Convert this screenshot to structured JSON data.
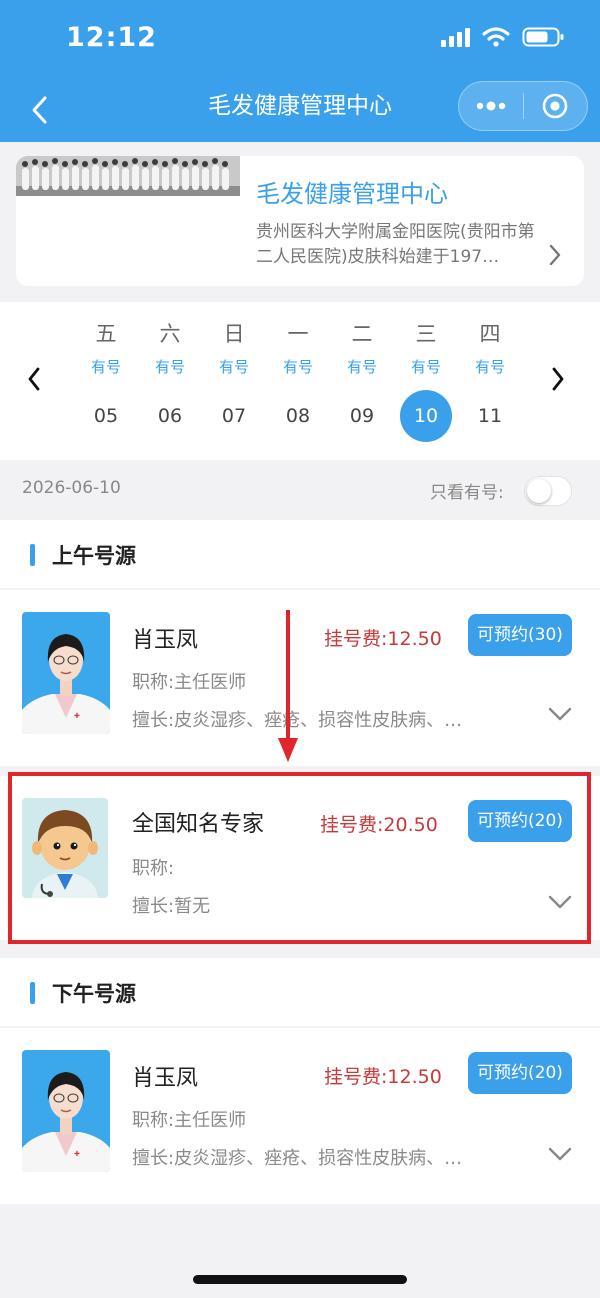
{
  "status_bar": {
    "time": "12:12"
  },
  "nav": {
    "title": "毛发健康管理中心"
  },
  "banner": {
    "title": "毛发健康管理中心",
    "description": "贵州医科大学附属金阳医院(贵阳市第二人民医院)皮肤科始建于197…"
  },
  "calendar": {
    "days": [
      {
        "weekday": "五",
        "availability": "有号",
        "date": "05"
      },
      {
        "weekday": "六",
        "availability": "有号",
        "date": "06"
      },
      {
        "weekday": "日",
        "availability": "有号",
        "date": "07"
      },
      {
        "weekday": "一",
        "availability": "有号",
        "date": "08"
      },
      {
        "weekday": "二",
        "availability": "有号",
        "date": "09"
      },
      {
        "weekday": "三",
        "availability": "有号",
        "date": "10"
      },
      {
        "weekday": "四",
        "availability": "有号",
        "date": "11"
      }
    ],
    "selected_date": "10"
  },
  "filter": {
    "date": "2026-06-10",
    "only_available_label": "只看有号:",
    "only_available_on": false
  },
  "morning": {
    "section_label": "上午号源",
    "doctors": [
      {
        "name": "肖玉凤",
        "fee_label": "挂号费:",
        "fee": "12.50",
        "button": "可预约(30)",
        "title_label": "职称:",
        "title": "主任医师",
        "specialty_label": "擅长:",
        "specialty": "皮炎湿疹、痤疮、损容性皮肤病、…"
      },
      {
        "name": "全国知名专家",
        "fee_label": "挂号费:",
        "fee": "20.50",
        "button": "可预约(20)",
        "title_label": "职称:",
        "title": "",
        "specialty_label": "擅长:",
        "specialty": "暂无"
      }
    ]
  },
  "afternoon": {
    "section_label": "下午号源",
    "doctors": [
      {
        "name": "肖玉凤",
        "fee_label": "挂号费:",
        "fee": "12.50",
        "button": "可预约(20)",
        "title_label": "职称:",
        "title": "主任医师",
        "specialty_label": "擅长:",
        "specialty": "皮炎湿疹、痤疮、损容性皮肤病、…"
      }
    ]
  },
  "colors": {
    "accent": "#3aa0ec",
    "fee": "#c8393a",
    "annotation": "#e0262a"
  },
  "icons": [
    "signal-icon",
    "wifi-icon",
    "battery-icon",
    "back-arrow-icon",
    "more-dots-icon",
    "target-icon",
    "chevron-right-icon",
    "chevron-left-icon",
    "chevron-down-icon",
    "doctor-avatar",
    "cartoon-avatar"
  ]
}
